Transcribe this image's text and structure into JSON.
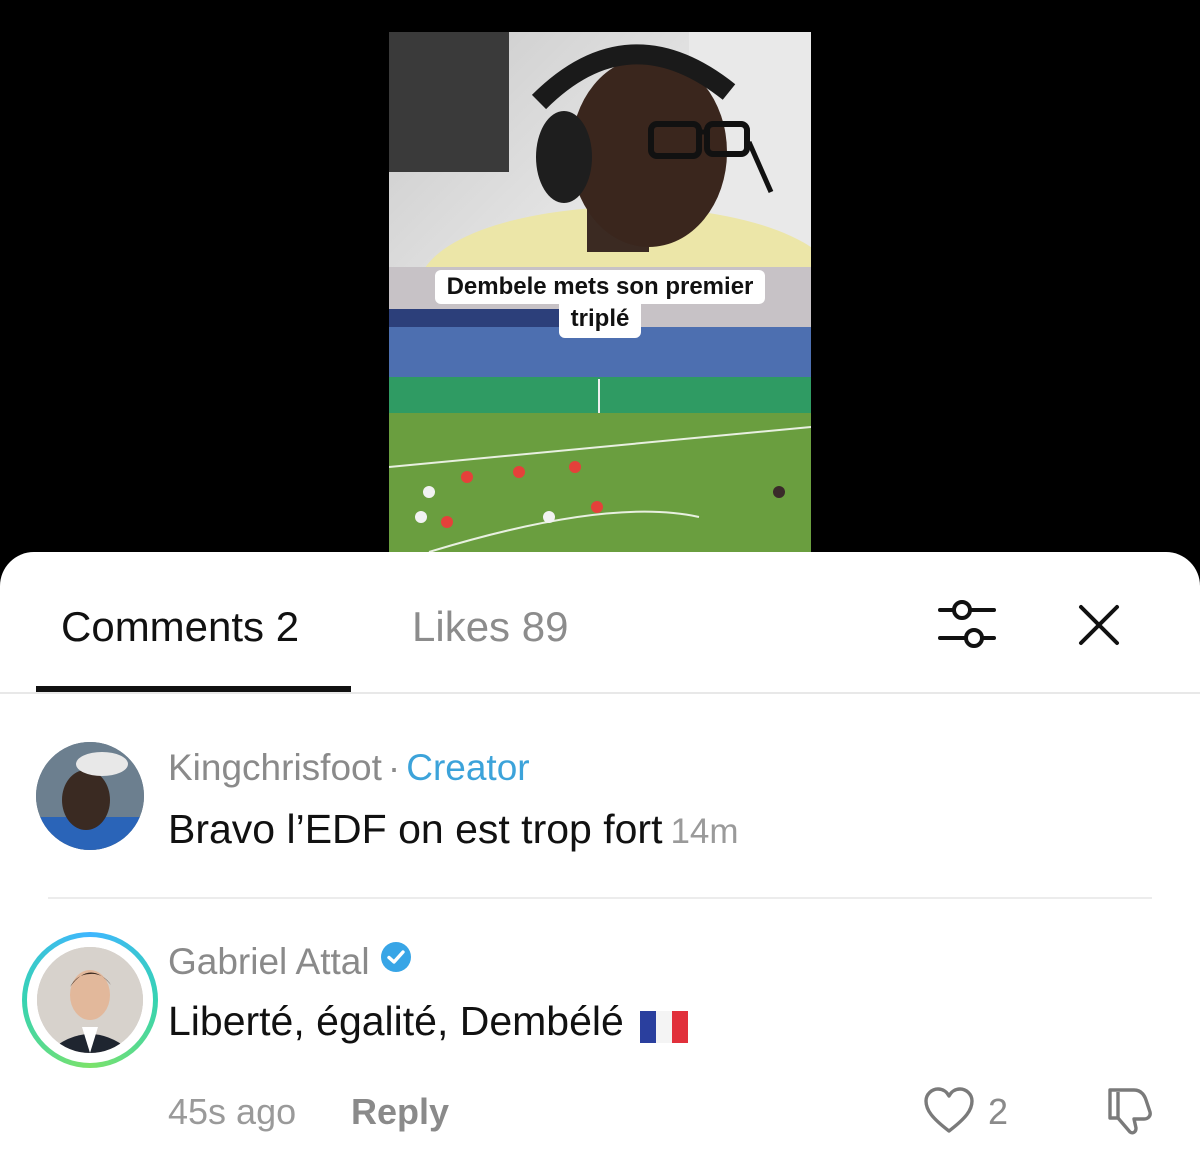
{
  "video": {
    "caption_line1": "Dembele mets son premier",
    "caption_line2": "triplé"
  },
  "tabs": {
    "comments_label": "Comments 2",
    "likes_label": "Likes 89",
    "active": "comments"
  },
  "icons": {
    "filter": "filter-sliders-icon",
    "close": "close-icon",
    "verified": "verified-badge-icon",
    "like": "heart-icon",
    "dislike": "thumbs-down-icon"
  },
  "comments": [
    {
      "author": "Kingchrisfoot",
      "separator": "·",
      "role": "Creator",
      "text": "Bravo l’EDF on est trop fort",
      "time": "14m"
    },
    {
      "author": "Gabriel Attal",
      "verified": true,
      "text": "Liberté, égalité, Dembélé",
      "flag": "🇫🇷",
      "time": "45s ago",
      "reply_label": "Reply",
      "likes": "2"
    }
  ],
  "colors": {
    "creator_accent": "#3ca3da",
    "verified": "#38a5e6",
    "avatar_ring": "#36d3b2"
  }
}
